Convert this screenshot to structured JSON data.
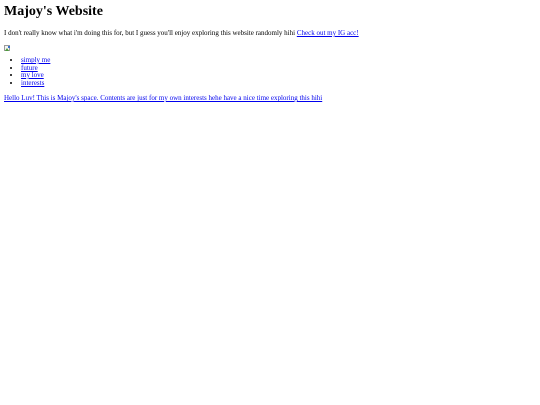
{
  "page": {
    "title": "Majoy's Website",
    "intro_text": "I don't really know what i'm doing this for, but I guess you'll enjoy exploring this website randomly hihi ",
    "ig_link_text": "Check out my IG acc!",
    "image_icon": "broken-image-icon"
  },
  "nav": {
    "items": [
      {
        "label": "simply me"
      },
      {
        "label": "future"
      },
      {
        "label": "my love"
      },
      {
        "label": "interests"
      }
    ]
  },
  "footer": {
    "greeting_link_text": "Hello Luv! This is Majoy's space. Contents are just for my own interests hehe have a nice time exploring this hihi"
  },
  "colors": {
    "link": "#0000ee",
    "text": "#000000",
    "background": "#ffffff"
  }
}
